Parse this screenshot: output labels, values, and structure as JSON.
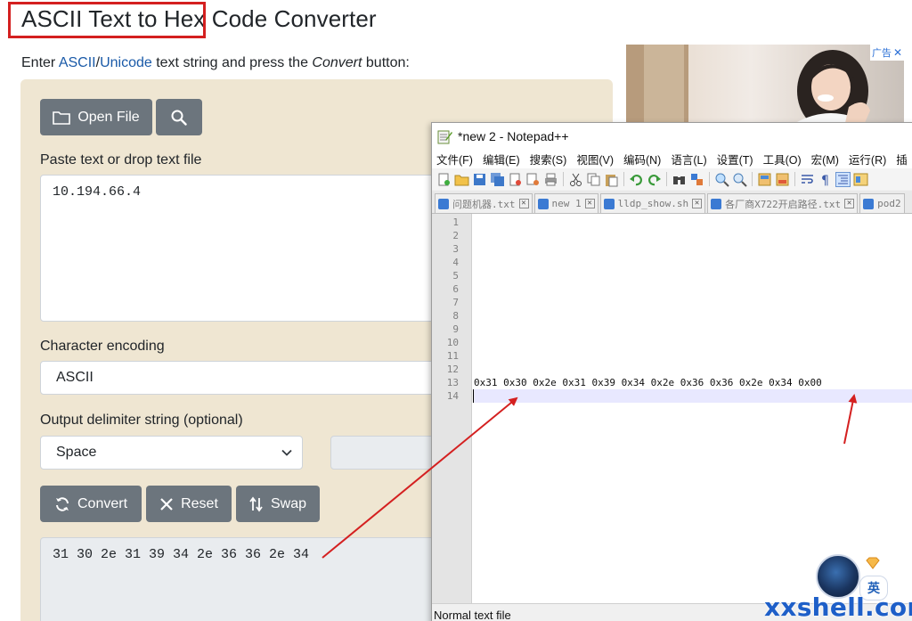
{
  "page": {
    "title": "ASCII Text to Hex Code Converter",
    "intro": {
      "prefix": "Enter ",
      "link_ascii": "ASCII",
      "slash": "/",
      "link_unicode": "Unicode",
      "mid": " text string and press the ",
      "emph": "Convert",
      "suffix": " button:"
    },
    "buttons": {
      "open_file": "Open File",
      "convert": "Convert",
      "reset": "Reset",
      "swap": "Swap"
    },
    "paste_label": "Paste text or drop text file",
    "input_text": "10.194.66.4",
    "encoding_label": "Character encoding",
    "encoding_value": "ASCII",
    "delimiter_label": "Output delimiter string (optional)",
    "delimiter_value": "Space",
    "output_text": "31 30 2e 31 39 34 2e 36 36 2e 34",
    "ad_label": "广告"
  },
  "notepad": {
    "title": "*new 2 - Notepad++",
    "menu": [
      "文件(F)",
      "编辑(E)",
      "搜索(S)",
      "视图(V)",
      "编码(N)",
      "语言(L)",
      "设置(T)",
      "工具(O)",
      "宏(M)",
      "运行(R)",
      "插"
    ],
    "tabs": [
      "问题机器.txt",
      "new 1",
      "lldp_show.sh",
      "各厂商X722开启路径.txt",
      "pod2"
    ],
    "line_numbers": [
      "1",
      "2",
      "3",
      "4",
      "5",
      "6",
      "7",
      "8",
      "9",
      "10",
      "11",
      "12",
      "13",
      "14"
    ],
    "line13_text": "0x31 0x30 0x2e 0x31 0x39 0x34 0x2e 0x36 0x36 0x2e 0x34 0x00",
    "status": "Normal text file",
    "toolbar_icons": [
      "new-file-icon",
      "open-file-icon",
      "save-icon",
      "save-all-icon",
      "close-icon",
      "close-all-icon",
      "print-icon",
      "cut-icon",
      "copy-icon",
      "paste-icon",
      "undo-icon",
      "redo-icon",
      "find-icon",
      "replace-icon",
      "zoom-in-icon",
      "zoom-out-icon",
      "sync-v-icon",
      "sync-h-icon",
      "word-wrap-icon",
      "show-all-chars-icon",
      "indent-guide-icon",
      "doc-map-icon"
    ]
  },
  "overlay": {
    "ime_label": "英",
    "watermark": "xxshell.com"
  },
  "colors": {
    "panel_bg": "#efe6d2",
    "button_bg": "#6c757d",
    "highlight_red": "#d42020",
    "link_blue": "#1a5aa8",
    "watermark_blue": "#1e5fc8"
  }
}
